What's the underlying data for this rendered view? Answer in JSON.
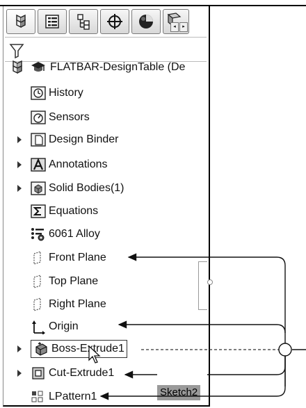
{
  "tabs": [
    {
      "icon": "feature-manager-icon"
    },
    {
      "icon": "property-manager-icon"
    },
    {
      "icon": "configuration-manager-icon"
    },
    {
      "icon": "dimxpert-manager-icon"
    },
    {
      "icon": "display-manager-icon"
    },
    {
      "icon": "cam-manager-icon"
    }
  ],
  "tab_scroll": {
    "left": "◂",
    "right": "▸"
  },
  "filter": {
    "icon": "filter-icon"
  },
  "tree": {
    "root": {
      "label": "FLATBAR-DesignTable  (De",
      "icon": "part-icon"
    },
    "items": [
      {
        "label": "History",
        "icon": "history-icon",
        "expandable": false
      },
      {
        "label": "Sensors",
        "icon": "sensors-icon",
        "expandable": false
      },
      {
        "label": "Design Binder",
        "icon": "design-binder-icon",
        "expandable": true
      },
      {
        "label": "Annotations",
        "icon": "annotations-icon",
        "expandable": true
      },
      {
        "label": "Solid Bodies(1)",
        "icon": "solid-bodies-icon",
        "expandable": true
      },
      {
        "label": "Equations",
        "icon": "equations-icon",
        "expandable": false
      },
      {
        "label": "6061 Alloy",
        "icon": "material-icon",
        "expandable": false
      },
      {
        "label": "Front Plane",
        "icon": "plane-icon",
        "expandable": false
      },
      {
        "label": "Top Plane",
        "icon": "plane-icon",
        "expandable": false
      },
      {
        "label": "Right Plane",
        "icon": "plane-icon",
        "expandable": false
      },
      {
        "label": "Origin",
        "icon": "origin-icon",
        "expandable": false
      },
      {
        "label": "Boss-Extrude1",
        "icon": "boss-extrude-icon",
        "expandable": true
      },
      {
        "label": "Cut-Extrude1",
        "icon": "cut-extrude-icon",
        "expandable": true
      },
      {
        "label": "LPattern1",
        "icon": "linear-pattern-icon",
        "expandable": false
      }
    ]
  },
  "callout": {
    "sketch_label": "Sketch2"
  }
}
